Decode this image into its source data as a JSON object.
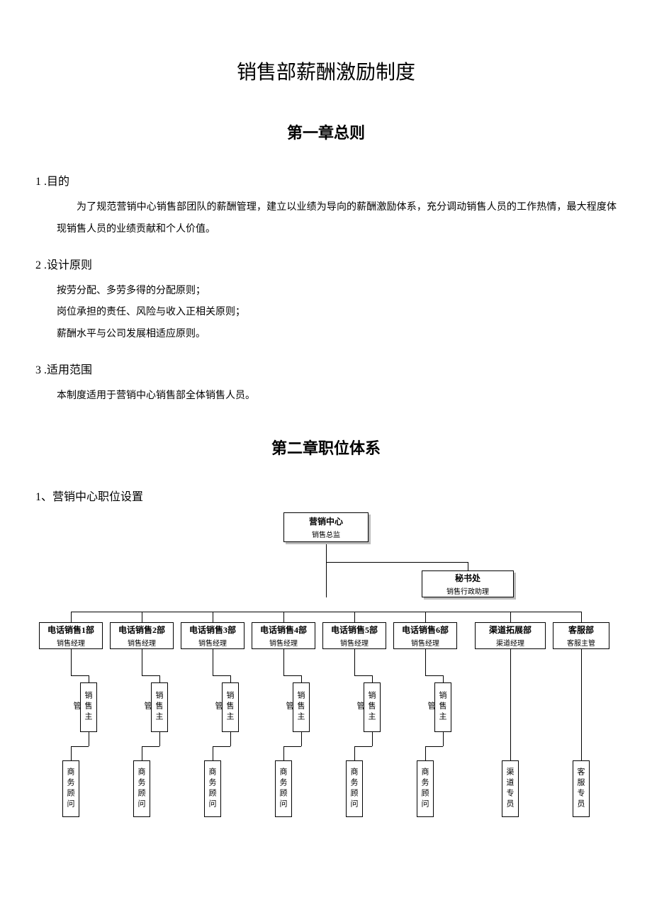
{
  "doc_title": "销售部薪酬激励制度",
  "chapter1": {
    "title": "第一章总则",
    "sec1_h": "1 .目的",
    "sec1_p": "为了规范营销中心销售部团队的薪酬管理，建立以业绩为导向的薪酬激励体系，充分调动销售人员的工作热情，最大程度体现销售人员的业绩贡献和个人价值。",
    "sec2_h": "2 .设计原则",
    "sec2_l1": "按劳分配、多劳多得的分配原则；",
    "sec2_l2": "岗位承担的责任、风险与收入正相关原则；",
    "sec2_l3": "薪酬水平与公司发展相适应原则。",
    "sec3_h": "3 .适用范围",
    "sec3_p": "本制度适用于营销中心销售部全体销售人员。"
  },
  "chapter2": {
    "title": "第二章职位体系",
    "sec1_h": "1、营销中心职位设置"
  },
  "org": {
    "top": {
      "title": "营销中心",
      "sub": "销售总监"
    },
    "secretary": {
      "title": "秘书处",
      "sub": "销售行政助理"
    },
    "row": [
      {
        "title": "电话销售1部",
        "sub": "销售经理"
      },
      {
        "title": "电话销售2部",
        "sub": "销售经理"
      },
      {
        "title": "电话销售3部",
        "sub": "销售经理"
      },
      {
        "title": "电话销售4部",
        "sub": "销售经理"
      },
      {
        "title": "电话销售5部",
        "sub": "销售经理"
      },
      {
        "title": "电话销售6部",
        "sub": "销售经理"
      },
      {
        "title": "渠道拓展部",
        "sub": "渠道经理"
      },
      {
        "title": "客服部",
        "sub": "客服主管"
      }
    ],
    "mid_label": "销售主管",
    "bottom": [
      "商务顾问",
      "商务顾问",
      "商务顾问",
      "商务顾问",
      "商务顾问",
      "商务顾问",
      "渠道专员",
      "客服专员"
    ]
  }
}
